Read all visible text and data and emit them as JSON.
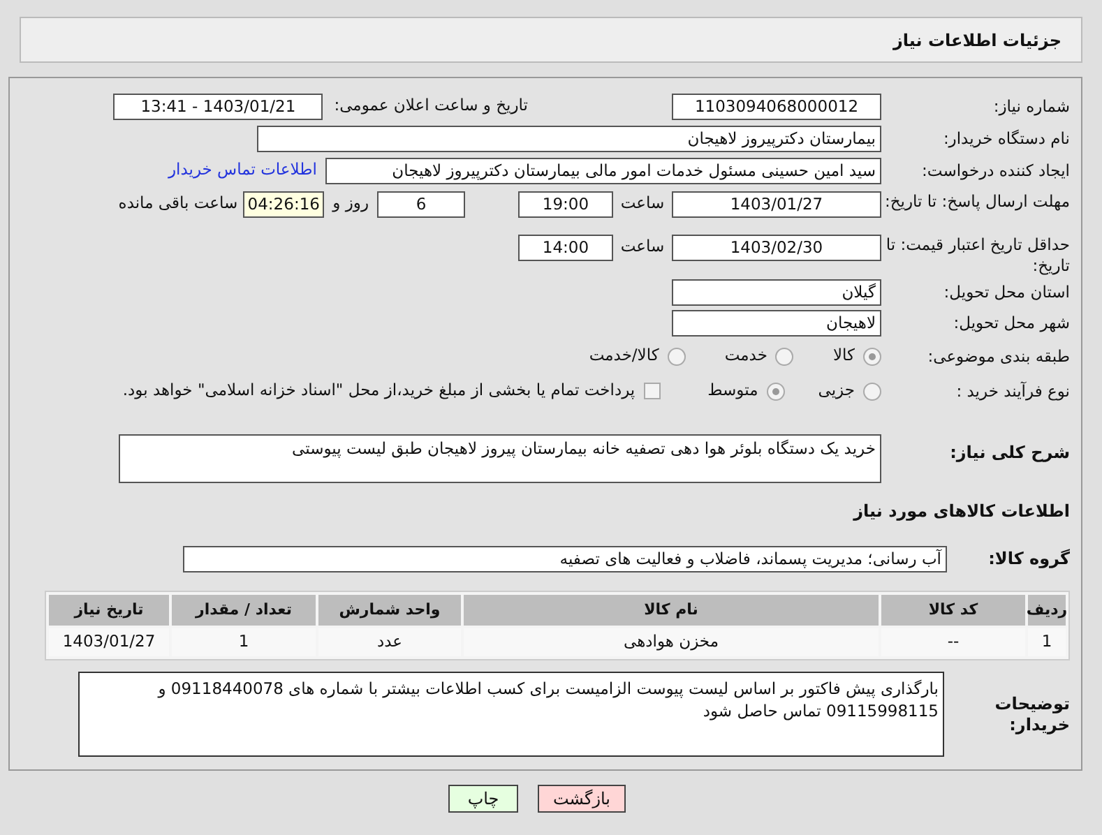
{
  "header": {
    "title": "جزئیات اطلاعات نیاز"
  },
  "need_number": {
    "label": "شماره نیاز:",
    "value": "1103094068000012"
  },
  "announce": {
    "label": "تاریخ و ساعت اعلان عمومی:",
    "value": "1403/01/21 - 13:41"
  },
  "buyer_org": {
    "label": "نام دستگاه خریدار:",
    "value": "بیمارستان دکترپیروز لاهیجان"
  },
  "requester": {
    "label": "ایجاد کننده درخواست:",
    "value": "سید امین حسینی مسئول خدمات امور مالی بیمارستان دکترپیروز لاهیجان",
    "link": "اطلاعات تماس خریدار"
  },
  "reply_deadline": {
    "label": "مهلت ارسال پاسخ: تا تاریخ:",
    "date": "1403/01/27",
    "time_label": "ساعت",
    "time": "19:00",
    "days": "6",
    "days_label": "روز و",
    "remaining": "04:26:16",
    "remaining_label": "ساعت باقی مانده"
  },
  "price_validity": {
    "label": "حداقل تاریخ اعتبار قیمت: تا تاریخ:",
    "date": "1403/02/30",
    "time_label": "ساعت",
    "time": "14:00"
  },
  "province": {
    "label": "استان محل تحویل:",
    "value": "گیلان"
  },
  "city": {
    "label": "شهر محل تحویل:",
    "value": "لاهیجان"
  },
  "category": {
    "label": "طبقه بندی موضوعی:",
    "options": [
      {
        "label": "کالا",
        "selected": true
      },
      {
        "label": "خدمت",
        "selected": false
      },
      {
        "label": "کالا/خدمت",
        "selected": false
      }
    ]
  },
  "purchase_type": {
    "label": "نوع فرآیند خرید :",
    "options": [
      {
        "label": "جزیی",
        "selected": false
      },
      {
        "label": "متوسط",
        "selected": true
      }
    ],
    "payment": {
      "label": "پرداخت تمام یا بخشی از مبلغ خرید،از محل \"اسناد خزانه اسلامی\" خواهد بود.",
      "checked": false
    }
  },
  "description": {
    "label": "شرح کلی نیاز:",
    "value": "خرید یک دستگاه بلوئر هوا دهی تصفیه خانه بیمارستان پیروز لاهیجان طبق لیست پیوستی"
  },
  "items_title": "اطلاعات کالاهای مورد نیاز",
  "goods_group": {
    "label": "گروه کالا:",
    "value": "آب رسانی؛ مدیریت پسماند، فاضلاب و فعالیت های تصفیه"
  },
  "table": {
    "columns": [
      "ردیف",
      "کد کالا",
      "نام کالا",
      "واحد شمارش",
      "تعداد / مقدار",
      "تاریخ نیاز"
    ],
    "rows": [
      [
        "1",
        "--",
        "مخزن هوادهی",
        "عدد",
        "1",
        "1403/01/27"
      ]
    ]
  },
  "buyer_notes": {
    "label": "توضیحات خریدار:",
    "value": "بارگذاری پیش فاکتور بر اساس لیست پیوست الزامیست برای کسب اطلاعات بیشتر با شماره های 09118440078 و 09115998115 تماس حاصل شود"
  },
  "buttons": [
    {
      "label": "بازگشت",
      "kind": "back"
    },
    {
      "label": "چاپ",
      "kind": "print"
    }
  ]
}
